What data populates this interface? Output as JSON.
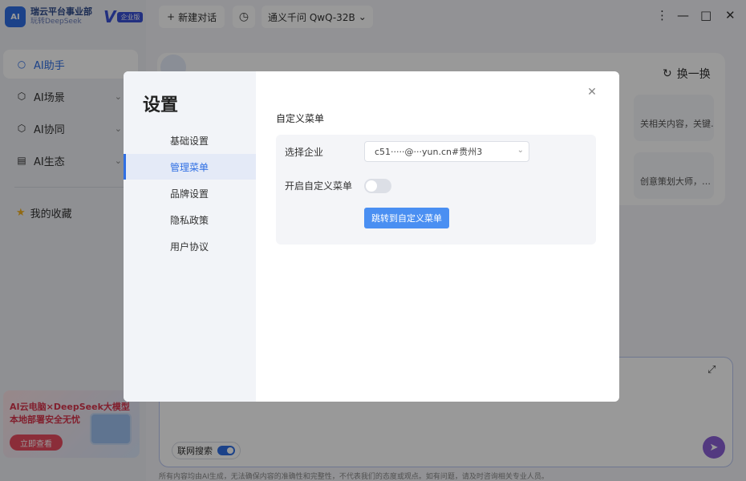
{
  "app": {
    "brand_name": "瑞云平台事业部",
    "brand_sub": "玩转DeepSeek",
    "edition_badge": "企业版"
  },
  "sidebar": {
    "items": [
      {
        "label": "AI助手",
        "icon": "chat-icon"
      },
      {
        "label": "AI场景",
        "icon": "cube-icon"
      },
      {
        "label": "AI协同",
        "icon": "cube-icon"
      },
      {
        "label": "AI生态",
        "icon": "book-icon"
      }
    ],
    "favorites_label": "我的收藏"
  },
  "promo": {
    "line1": "AI云电脑×DeepSeek大模型",
    "line2": "本地部署安全无忧",
    "button": "立即查看"
  },
  "topbar": {
    "new_chat": "新建对话",
    "model": "通义千问 QwQ-32B"
  },
  "main": {
    "refresh_label": "换一换",
    "suggestions": [
      "关相关内容，关键…",
      "创意策划大师，…"
    ]
  },
  "input": {
    "web_search_label": "联网搜索"
  },
  "footer": {
    "disclaimer": "所有内容均由AI生成，无法确保内容的准确性和完整性，不代表我们的态度或观点。如有问题，请及时咨询相关专业人员。"
  },
  "modal": {
    "title": "设置",
    "menu": [
      "基础设置",
      "管理菜单",
      "品牌设置",
      "隐私政策",
      "用户协议"
    ],
    "active_menu": 1,
    "section_title": "自定义菜单",
    "fields": {
      "company_label": "选择企业",
      "company_value": "c51·····@···yun.cn#贵州3",
      "custom_menu_label": "开启自定义菜单",
      "custom_menu_enabled": false
    },
    "jump_button": "跳转到自定义菜单"
  }
}
